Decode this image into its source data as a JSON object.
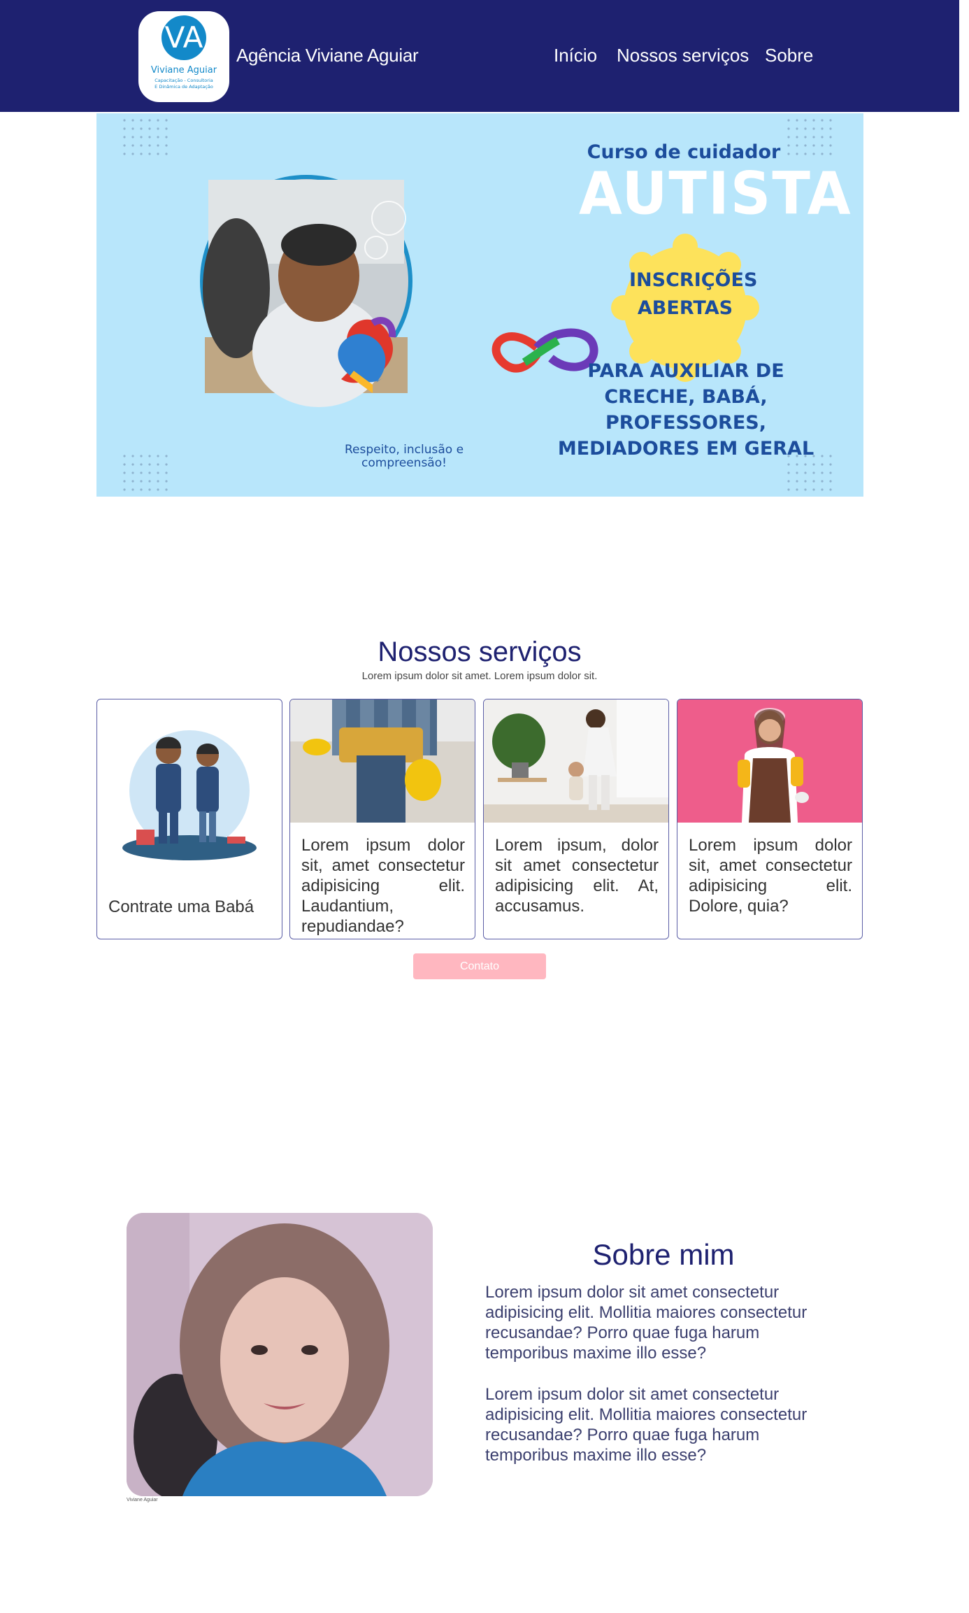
{
  "header": {
    "logo_text": "Viviane Aguiar",
    "logo_tagline": "Capacitação - Consultoria E Dinâmica de Adaptação",
    "brand": "Agência Viviane Aguiar",
    "nav": [
      "Início",
      "Nossos serviços",
      "Sobre"
    ]
  },
  "hero": {
    "course_line": "Curso de cuidador",
    "course_title": "AUTISTA",
    "badge": "INSCRIÇÕES ABERTAS",
    "audience": "PARA AUXILIAR DE CRECHE, BABÁ, PROFESSORES, MEDIADORES EM GERAL",
    "motto": "Respeito, inclusão e compreensão!"
  },
  "services": {
    "title": "Nossos serviços",
    "subtitle": "Lorem ipsum dolor sit amet. Lorem ipsum dolor sit.",
    "cards": [
      {
        "text": "Contrate uma Babá"
      },
      {
        "text": "Lorem ipsum dolor sit, amet consectetur adipisicing elit. Laudantium, repudiandae?"
      },
      {
        "text": "Lorem ipsum, dolor sit amet consectetur adipisicing elit. At, accusamus."
      },
      {
        "text": "Lorem ipsum dolor sit, amet consectetur adipisicing elit. Dolore, quia?"
      }
    ],
    "contact_button": "Contato"
  },
  "about": {
    "title": "Sobre mim",
    "photo_caption": "Viviane Aguiar",
    "paragraphs": [
      "Lorem ipsum dolor sit amet consectetur adipisicing elit. Mollitia maiores consectetur recusandae? Porro quae fuga harum temporibus maxime illo esse?",
      "Lorem ipsum dolor sit amet consectetur adipisicing elit. Mollitia maiores consectetur recusandae? Porro quae fuga harum temporibus maxime illo esse?"
    ]
  },
  "colors": {
    "header_bg": "#1e2170",
    "hero_bg": "#b8e6fb",
    "accent_blue": "#1c4d9c",
    "badge_yellow": "#fde25b",
    "button_pink": "#ffb7c0",
    "card_border": "#5b5ea6"
  }
}
